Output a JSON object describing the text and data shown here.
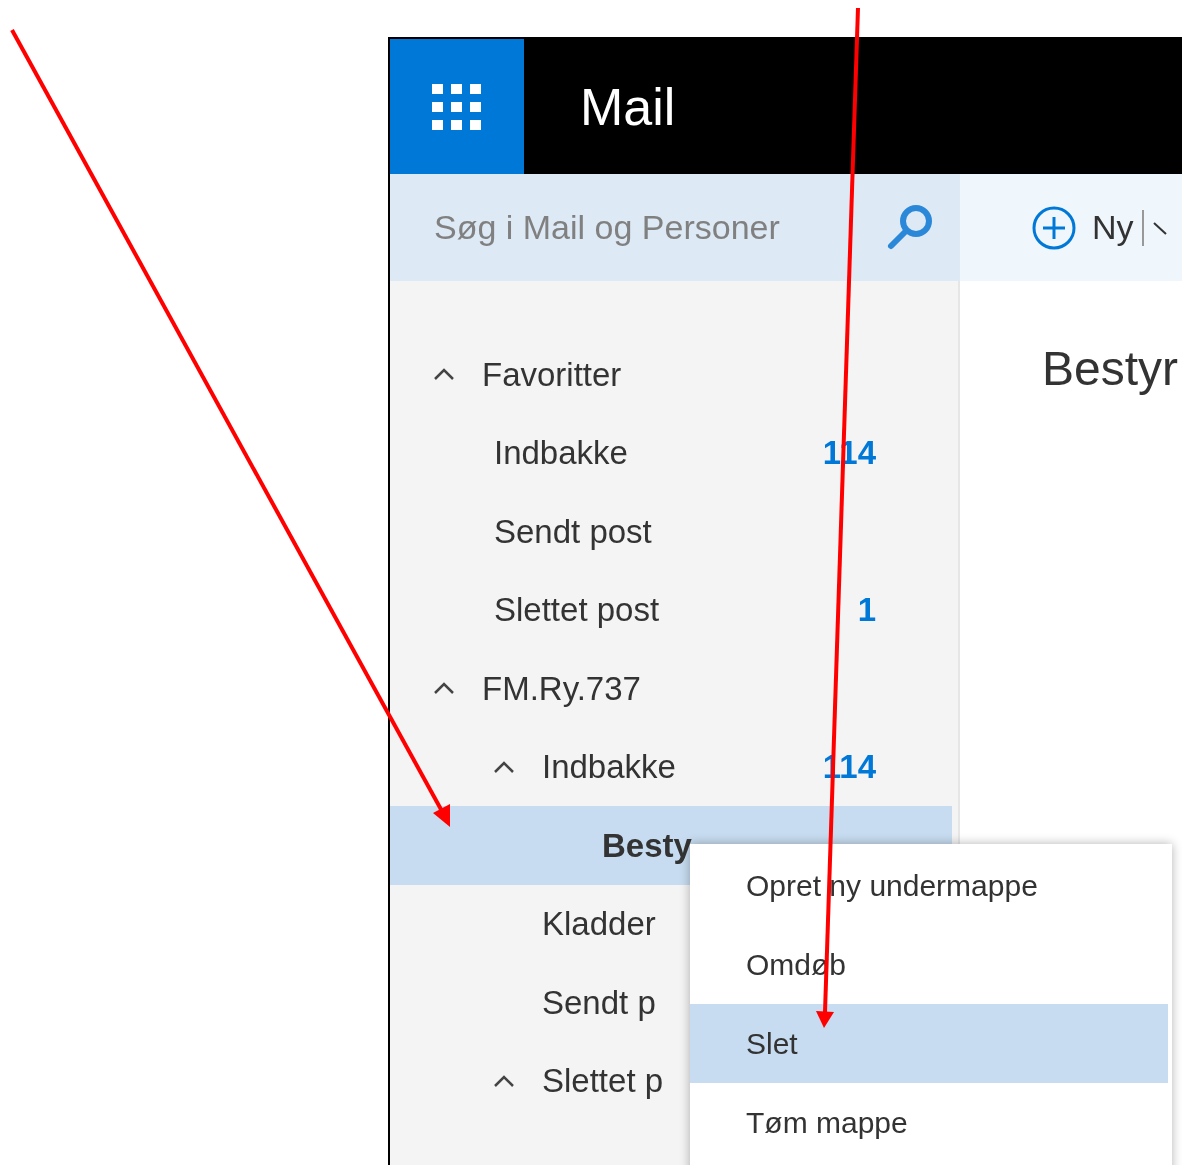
{
  "header": {
    "app_title": "Mail"
  },
  "search": {
    "placeholder": "Søg i Mail og Personer"
  },
  "toolbar": {
    "new_label": "Ny"
  },
  "folders": [
    {
      "label": "Favoritter",
      "kind": "favorites",
      "expanded": true,
      "selected": false,
      "children": [
        {
          "label": "Indbakke",
          "count": "114",
          "selected": false
        },
        {
          "label": "Sendt post",
          "selected": false
        },
        {
          "label": "Slettet post",
          "count": "1",
          "selected": false
        }
      ]
    },
    {
      "label": "FM.Ry.737",
      "kind": "account",
      "expanded": true,
      "selected": false,
      "children": [
        {
          "label": "Indbakke",
          "count": "114",
          "expanded": true,
          "selected": false,
          "children": [
            {
              "label": "Besty",
              "selected": true
            }
          ]
        },
        {
          "label": "Kladder",
          "selected": false
        },
        {
          "label": "Sendt p",
          "selected": false
        },
        {
          "label": "Slettet p",
          "expanded": true,
          "selected": false
        }
      ]
    }
  ],
  "reading_pane": {
    "heading": "Bestyr"
  },
  "context_menu": [
    {
      "label": "Opret ny undermappe",
      "selected": false
    },
    {
      "label": "Omdøb",
      "selected": false
    },
    {
      "label": "Slet",
      "selected": true
    },
    {
      "label": "Tøm mappe",
      "selected": false
    }
  ]
}
